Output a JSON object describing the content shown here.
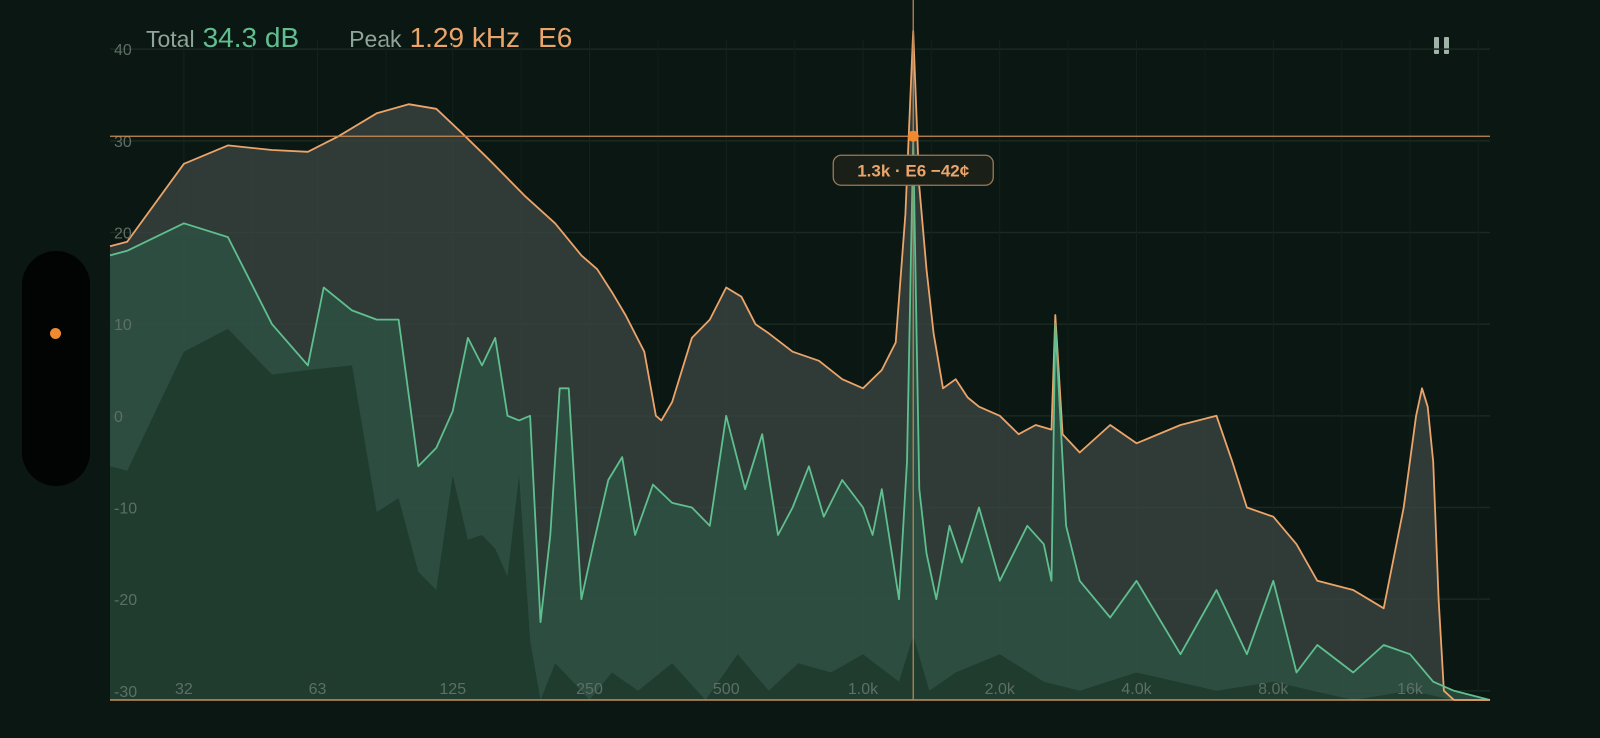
{
  "readout": {
    "total_label": "Total",
    "total_value": "34.3 dB",
    "peak_label": "Peak",
    "peak_freq": "1.29 kHz",
    "peak_note": "E6"
  },
  "controls": {
    "pause_icon": "pause-icon",
    "side_handle_icon": "dot-icon"
  },
  "colors": {
    "accent": "#eba46a",
    "green": "#5fbf8f",
    "background": "#0b1712",
    "handle": "#f08a30"
  },
  "chart_data": {
    "type": "area",
    "x_scale": "log",
    "xlim": [
      22,
      24000
    ],
    "ylim": [
      -31,
      41
    ],
    "grid": true,
    "y_ticks": [
      40,
      30,
      20,
      10,
      0,
      -10,
      -20,
      -30
    ],
    "y_tick_labels": [
      "40",
      "30",
      "20",
      "10",
      "0",
      "-10",
      "-20",
      "-30"
    ],
    "x_ticks": [
      32,
      63,
      125,
      250,
      500,
      1000,
      2000,
      4000,
      8000,
      16000
    ],
    "x_tick_labels": [
      "32",
      "63",
      "125",
      "250",
      "500",
      "1.0k",
      "2.0k",
      "4.0k",
      "8.0k",
      "16k"
    ],
    "cursor": {
      "freq": 1290,
      "level": 30.5,
      "tooltip": "1.3k · E6 −42¢"
    },
    "series": [
      {
        "color": "#eba46a",
        "x": [
          22,
          24,
          32,
          40,
          50,
          60,
          70,
          85,
          100,
          115,
          130,
          150,
          180,
          210,
          240,
          260,
          280,
          300,
          330,
          350,
          360,
          380,
          420,
          460,
          500,
          540,
          580,
          620,
          700,
          800,
          900,
          1000,
          1100,
          1180,
          1240,
          1290,
          1330,
          1380,
          1430,
          1500,
          1600,
          1700,
          1800,
          2000,
          2200,
          2400,
          2600,
          2650,
          2750,
          3000,
          3500,
          4000,
          5000,
          6000,
          6500,
          7000,
          8000,
          9000,
          10000,
          12000,
          14000,
          15500,
          16500,
          17000,
          17500,
          18000,
          18500,
          19000,
          20000,
          24000
        ],
        "values": [
          18.5,
          19,
          27.5,
          29.5,
          29,
          28.8,
          30.5,
          33,
          34,
          33.5,
          31,
          28,
          24,
          21,
          17.5,
          16,
          13.5,
          11,
          7,
          0,
          -0.5,
          1.5,
          8.5,
          10.5,
          14,
          13,
          10,
          9,
          7,
          6,
          4,
          3,
          5,
          8,
          22,
          42,
          25,
          16,
          9,
          3,
          4,
          2,
          1,
          0,
          -2,
          -1,
          -1.5,
          11,
          -2,
          -4,
          -1,
          -3,
          -1,
          0,
          -5,
          -10,
          -11,
          -14,
          -18,
          -19,
          -21,
          -10,
          0,
          3,
          1,
          -5,
          -20,
          -30,
          -31,
          -31
        ]
      },
      {
        "color": "#5fbf8f",
        "x": [
          22,
          24,
          32,
          40,
          50,
          60,
          65,
          75,
          85,
          95,
          105,
          115,
          125,
          135,
          145,
          155,
          165,
          175,
          185,
          195,
          205,
          215,
          225,
          240,
          255,
          275,
          295,
          315,
          345,
          380,
          420,
          460,
          500,
          550,
          600,
          650,
          700,
          760,
          820,
          900,
          1000,
          1050,
          1100,
          1200,
          1250,
          1290,
          1330,
          1380,
          1450,
          1550,
          1650,
          1800,
          2000,
          2300,
          2500,
          2600,
          2650,
          2800,
          3000,
          3500,
          4000,
          5000,
          6000,
          7000,
          8000,
          9000,
          10000,
          12000,
          14000,
          16000,
          18000,
          20000,
          24000
        ],
        "values": [
          17.5,
          18,
          21,
          19.5,
          10,
          5.5,
          14,
          11.5,
          10.5,
          10.5,
          -5.5,
          -3.5,
          0.5,
          8.5,
          5.5,
          8.5,
          0,
          -0.5,
          0,
          -22.5,
          -13,
          3,
          3,
          -20,
          -14,
          -7,
          -4.5,
          -13,
          -7.5,
          -9.5,
          -10,
          -12,
          0,
          -8,
          -2,
          -13,
          -10,
          -5.5,
          -11,
          -7,
          -10,
          -13,
          -8,
          -20,
          -5,
          30,
          -8,
          -15,
          -20,
          -12,
          -16,
          -10,
          -18,
          -12,
          -14,
          -18,
          10,
          -12,
          -18,
          -22,
          -18,
          -26,
          -19,
          -26,
          -18,
          -28,
          -25,
          -28,
          -25,
          -26,
          -29,
          -30,
          -31
        ]
      },
      {
        "color": "#3a4a44",
        "x": [
          22,
          24,
          32,
          40,
          50,
          60,
          75,
          85,
          95,
          105,
          115,
          125,
          135,
          145,
          155,
          165,
          175,
          185,
          195,
          210,
          230,
          250,
          280,
          320,
          380,
          450,
          530,
          620,
          720,
          850,
          1000,
          1200,
          1290,
          1400,
          1600,
          2000,
          2500,
          3000,
          4000,
          6000,
          8000,
          12000,
          16000,
          20000,
          24000
        ],
        "values": [
          -5.5,
          -6,
          7,
          9.5,
          4.5,
          5,
          5.5,
          -10.5,
          -9,
          -17,
          -19,
          -6.5,
          -13.5,
          -13,
          -14.5,
          -17.5,
          -6.5,
          -24.5,
          -31,
          -27,
          -29,
          -31,
          -28,
          -30,
          -27,
          -31,
          -26,
          -30,
          -27,
          -28,
          -26,
          -29,
          -24,
          -30,
          -28,
          -26,
          -29,
          -30,
          -28,
          -30,
          -29,
          -31,
          -30,
          -31,
          -31
        ]
      }
    ]
  }
}
